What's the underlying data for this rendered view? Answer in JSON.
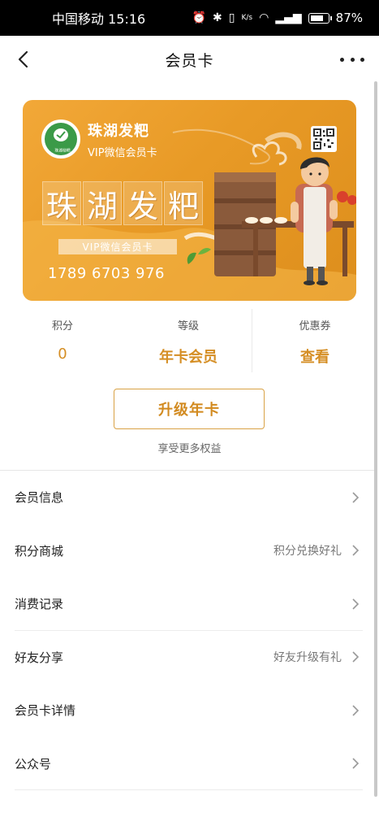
{
  "status_bar": {
    "carrier_time": "中国移动 15:16",
    "net_speed": "K/s",
    "battery_percent_text": "87%",
    "battery_level": 0.87
  },
  "nav": {
    "title": "会员卡"
  },
  "card": {
    "brand": "珠湖发粑",
    "type": "VIP微信会员卡",
    "big_title": [
      "珠",
      "湖",
      "发",
      "粑"
    ],
    "vip_strip": "VIP微信会员卡",
    "number": "1789 6703 976",
    "logo_text": "珠湖發粑",
    "accent": "#e89a26"
  },
  "stats": {
    "points_label": "积分",
    "points_value": "0",
    "level_label": "等级",
    "level_value": "年卡会员",
    "coupon_label": "优惠券",
    "coupon_value": "查看"
  },
  "upgrade": {
    "button": "升级年卡",
    "subtitle": "享受更多权益"
  },
  "menu": [
    {
      "label": "会员信息",
      "desc": ""
    },
    {
      "label": "积分商城",
      "desc": "积分兑换好礼"
    },
    {
      "label": "消费记录",
      "desc": ""
    },
    {
      "label": "好友分享",
      "desc": "好友升级有礼"
    },
    {
      "label": "会员卡详情",
      "desc": ""
    },
    {
      "label": "公众号",
      "desc": ""
    }
  ],
  "colors": {
    "accent": "#d58e24",
    "card_gradient_start": "#f2a838",
    "card_gradient_end": "#dd8e1c"
  }
}
